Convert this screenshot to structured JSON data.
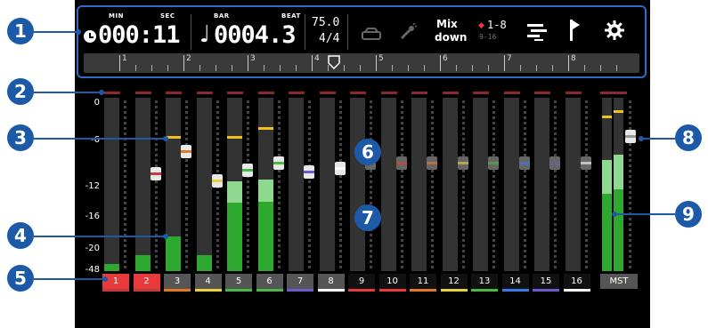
{
  "status": {
    "time_label": "MIN",
    "sec_label": "SEC",
    "time_value": "000:11",
    "bar_label": "BAR",
    "beat_label": "BEAT",
    "bar_value": "0004.3",
    "tempo": "75.0",
    "signature": "4/4"
  },
  "toolbar": {
    "mixdown_line1": "Mix",
    "mixdown_line2": "down",
    "track_group_top": "1-8",
    "track_group_bottom": "9-16"
  },
  "ruler": {
    "marks": [
      "1",
      "2",
      "3",
      "4",
      "5",
      "6",
      "7",
      "8"
    ]
  },
  "db_scale": [
    "0",
    "-6",
    "-12",
    "-16",
    "-20",
    "-48"
  ],
  "channels": [
    {
      "label": "1",
      "color": "#e83a3a",
      "bar": "#c23a3a",
      "selected": true,
      "level": 0.04,
      "fader": null
    },
    {
      "label": "2",
      "color": "#e83a3a",
      "bar": "#c23a3a",
      "selected": true,
      "level": 0.09,
      "fader": 0.6
    },
    {
      "label": "3",
      "color": "#444",
      "bar": "#e07a2a",
      "selected": false,
      "level": 0.2,
      "fader": 0.73
    },
    {
      "label": "4",
      "color": "#444",
      "bar": "#e6d23a",
      "selected": false,
      "level": 0.09,
      "fader": 0.56
    },
    {
      "label": "5",
      "color": "#444",
      "bar": "#49b849",
      "selected": false,
      "level": 0.52,
      "fader": 0.62
    },
    {
      "label": "6",
      "color": "#444",
      "bar": "#49b849",
      "selected": false,
      "level": 0.53,
      "fader": 0.66
    },
    {
      "label": "7",
      "color": "#444",
      "bar": "#6a5acd",
      "selected": false,
      "level": 0,
      "fader": 0.61
    },
    {
      "label": "8",
      "color": "#444",
      "bar": "#ffffff",
      "selected": false,
      "level": 0,
      "fader": 0.63
    },
    {
      "label": "9",
      "color": "#000",
      "bar": "#e83a3a",
      "selected": false,
      "level": 0,
      "fader": 0.66
    },
    {
      "label": "10",
      "color": "#000",
      "bar": "#e83a3a",
      "selected": false,
      "level": 0,
      "fader": 0.66
    },
    {
      "label": "11",
      "color": "#000",
      "bar": "#e07a2a",
      "selected": false,
      "level": 0,
      "fader": 0.66
    },
    {
      "label": "12",
      "color": "#000",
      "bar": "#e6d23a",
      "selected": false,
      "level": 0,
      "fader": 0.66
    },
    {
      "label": "13",
      "color": "#000",
      "bar": "#49b849",
      "selected": false,
      "level": 0,
      "fader": 0.66
    },
    {
      "label": "14",
      "color": "#000",
      "bar": "#3a7ae8",
      "selected": false,
      "level": 0,
      "fader": 0.66
    },
    {
      "label": "15",
      "color": "#000",
      "bar": "#6a5acd",
      "selected": false,
      "level": 0,
      "fader": 0.66
    },
    {
      "label": "16",
      "color": "#000",
      "bar": "#ffffff",
      "selected": false,
      "level": 0,
      "fader": 0.66
    }
  ],
  "master": {
    "label": "MST",
    "level_l": 0.64,
    "level_r": 0.67
  },
  "callouts": [
    "1",
    "2",
    "3",
    "4",
    "5",
    "6",
    "7",
    "8",
    "9"
  ]
}
